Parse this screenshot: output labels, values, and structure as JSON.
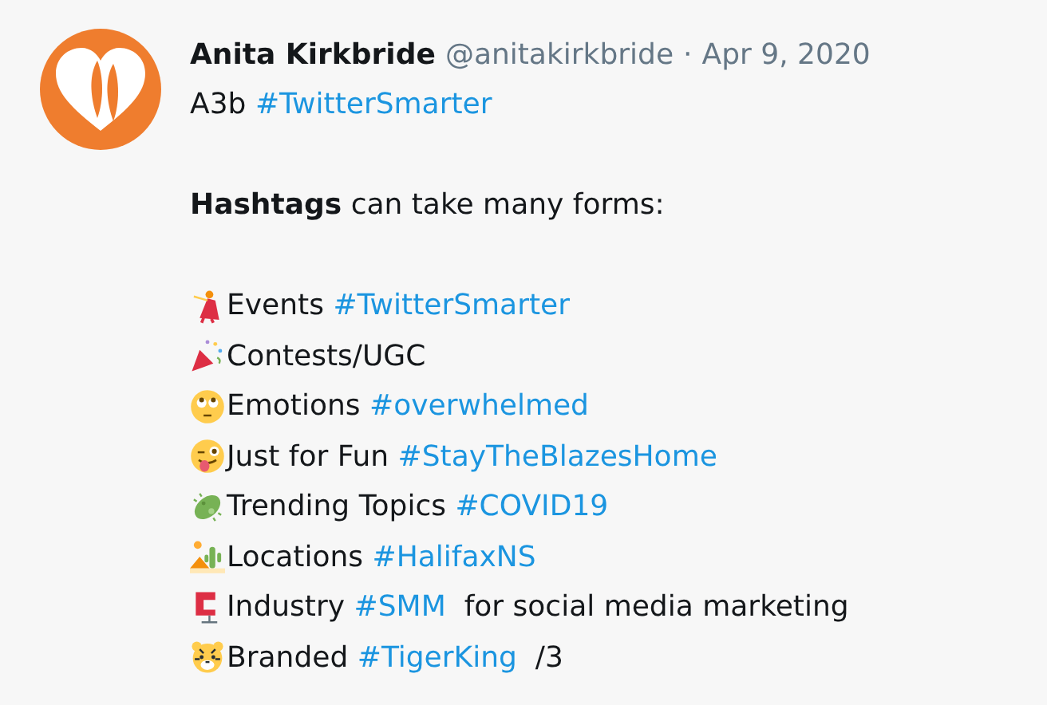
{
  "tweet": {
    "author": {
      "name": "Anita Kirkbride",
      "handle": "@anitakirkbride",
      "separator": "·",
      "date": "Apr 9, 2020"
    },
    "first_line": {
      "text": "A3b",
      "hashtag": "#TwitterSmarter"
    },
    "intro": "**Hashtags** can take many forms:",
    "lines": [
      {
        "kind": "dancer",
        "label": "Events",
        "hashtag": "#TwitterSmarter"
      },
      {
        "kind": "popper",
        "label": "Contests/UGC"
      },
      {
        "kind": "eyesup",
        "label": "Emotions",
        "hashtag": "#overwhelmed"
      },
      {
        "kind": "wink",
        "label": "Just for Fun",
        "hashtag": "#StayTheBlazesHome"
      },
      {
        "kind": "microbe",
        "label": "Trending Topics",
        "hashtag": "#COVID19"
      },
      {
        "kind": "desert",
        "label": "Locations",
        "hashtag": "#HalifaxNS"
      },
      {
        "kind": "clamp",
        "label": "Industry",
        "hashtag": "#SMM",
        "suffix": "for social media marketing"
      },
      {
        "kind": "tiger",
        "label": "Branded",
        "hashtag": "#TigerKing",
        "suffix": "/3"
      }
    ]
  }
}
